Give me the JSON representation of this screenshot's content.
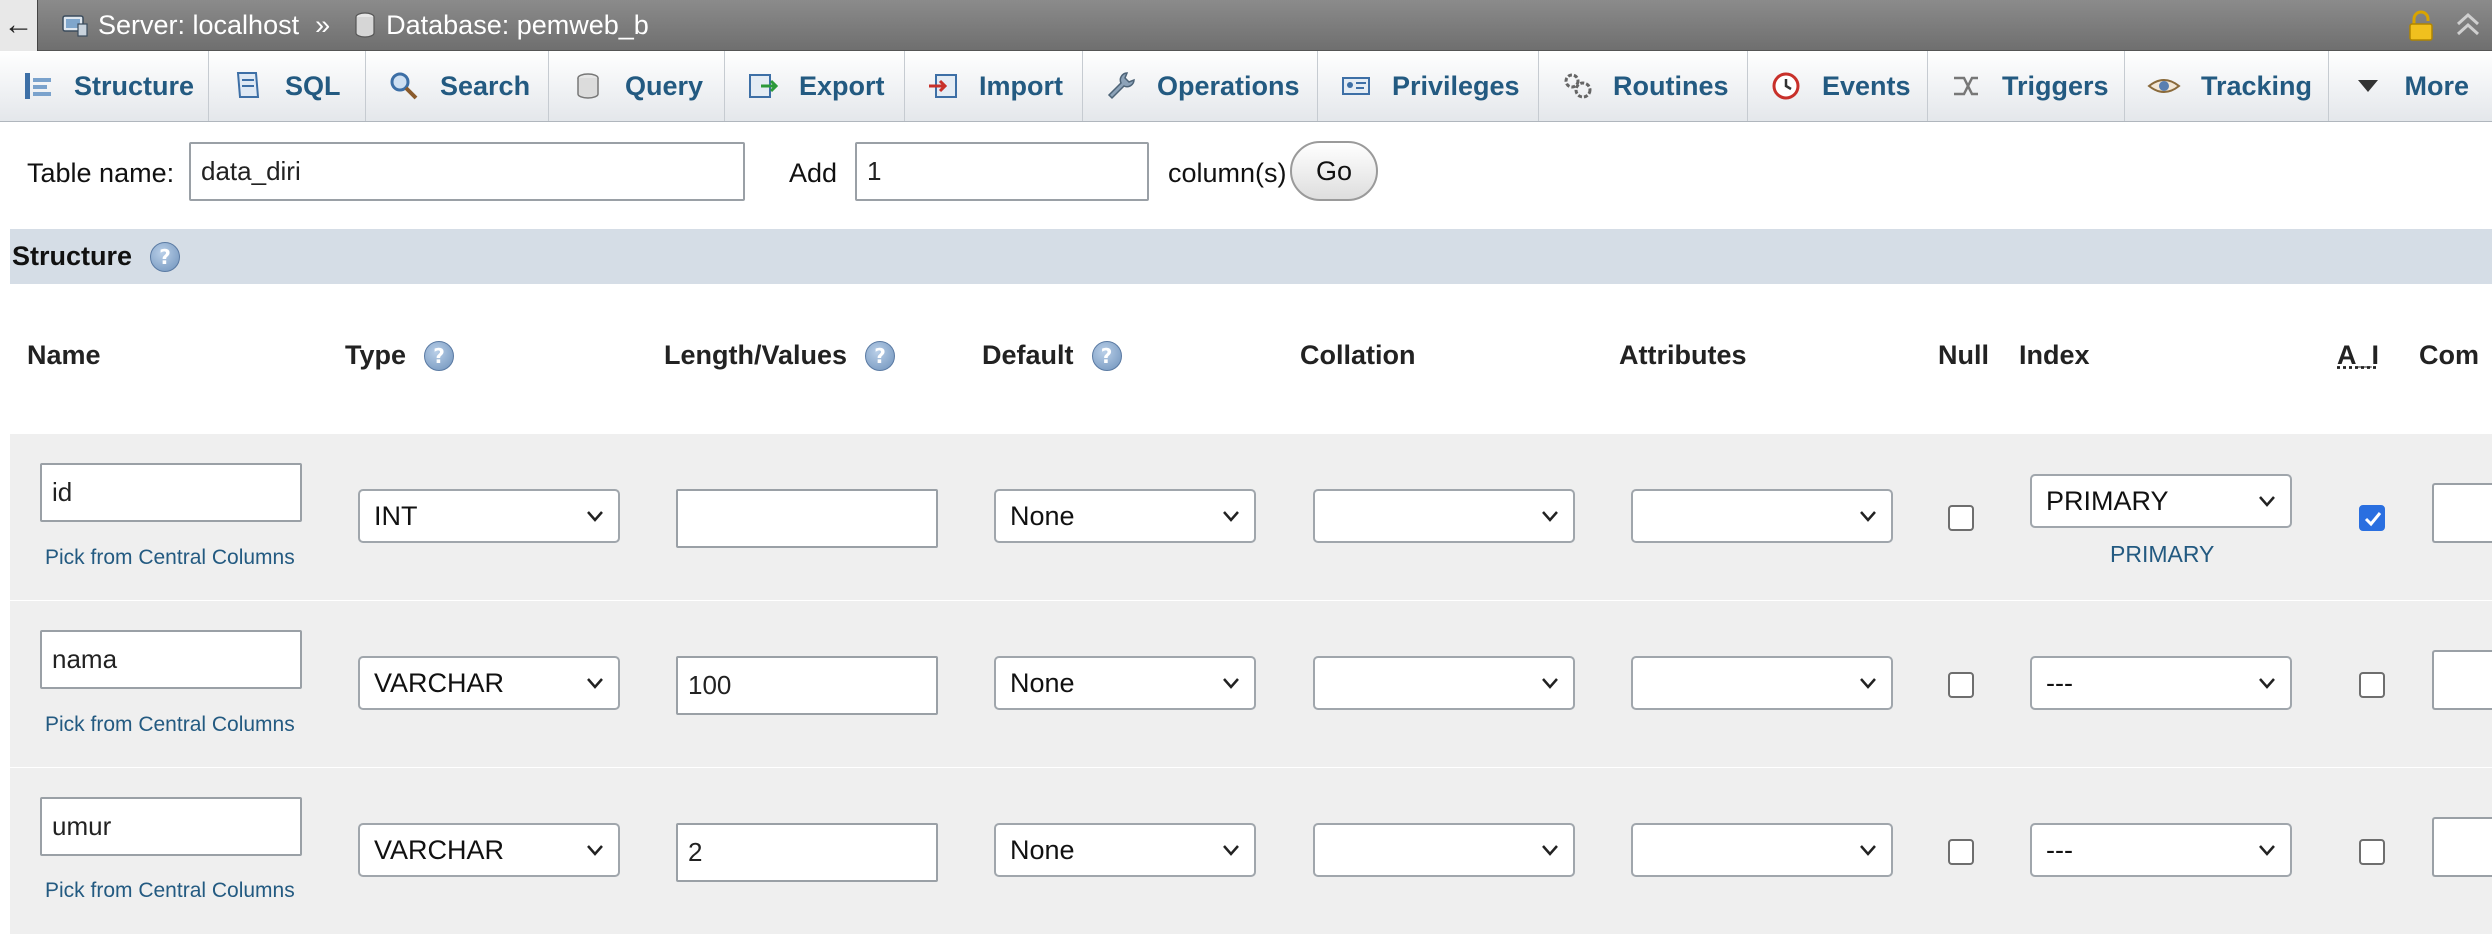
{
  "breadcrumb": {
    "server": "Server: localhost",
    "separator": "»",
    "database": "Database: pemweb_b"
  },
  "tabs": [
    {
      "label": "Structure",
      "icon": "structure-icon"
    },
    {
      "label": "SQL",
      "icon": "sql-icon"
    },
    {
      "label": "Search",
      "icon": "search-icon"
    },
    {
      "label": "Query",
      "icon": "query-icon"
    },
    {
      "label": "Export",
      "icon": "export-icon"
    },
    {
      "label": "Import",
      "icon": "import-icon"
    },
    {
      "label": "Operations",
      "icon": "wrench-icon"
    },
    {
      "label": "Privileges",
      "icon": "privileges-icon"
    },
    {
      "label": "Routines",
      "icon": "routines-icon"
    },
    {
      "label": "Events",
      "icon": "clock-icon"
    },
    {
      "label": "Triggers",
      "icon": "triggers-icon"
    },
    {
      "label": "Tracking",
      "icon": "eye-icon"
    },
    {
      "label": "More",
      "icon": "caret-down-icon"
    }
  ],
  "table_form": {
    "name_label": "Table name:",
    "name_value": "data_diri",
    "add_label": "Add",
    "add_value": "1",
    "columns_label": "column(s)",
    "go_label": "Go"
  },
  "structure": {
    "title": "Structure",
    "help": "?",
    "columns": {
      "name": "Name",
      "type": "Type",
      "length": "Length/Values",
      "default": "Default",
      "collation": "Collation",
      "attributes": "Attributes",
      "null": "Null",
      "index": "Index",
      "ai": "A_I",
      "comments": "Com"
    }
  },
  "fields": [
    {
      "name": "id",
      "pick": "Pick from Central Columns",
      "type": "INT",
      "length": "",
      "default": "None",
      "collation": "",
      "attributes": "",
      "null": false,
      "index": "PRIMARY",
      "index_link": "PRIMARY",
      "ai": true
    },
    {
      "name": "nama",
      "pick": "Pick from Central Columns",
      "type": "VARCHAR",
      "length": "100",
      "default": "None",
      "collation": "",
      "attributes": "",
      "null": false,
      "index": "---",
      "index_link": "",
      "ai": false
    },
    {
      "name": "umur",
      "pick": "Pick from Central Columns",
      "type": "VARCHAR",
      "length": "2",
      "default": "None",
      "collation": "",
      "attributes": "",
      "null": false,
      "index": "---",
      "index_link": "",
      "ai": false
    }
  ],
  "colors": {
    "link": "#235a81",
    "topbar": "#7a7a7a",
    "structure_band": "#d5dde6",
    "row_bg": "#efefef",
    "checkbox_on": "#2a6fe0"
  }
}
